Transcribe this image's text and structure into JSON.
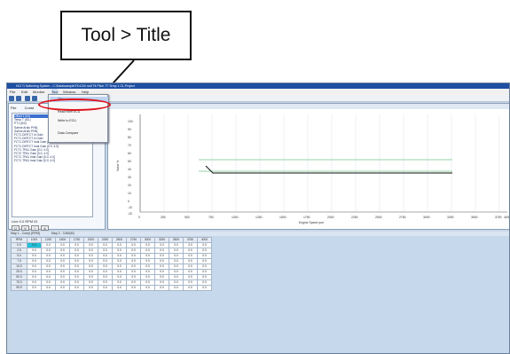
{
  "callout": {
    "text": "Tool > Title"
  },
  "window": {
    "title": "HCI Ti Switching System - C:\\Data\\sample\\TK4100.mdf  Tlt Pitch 7T  Temp 1 CL.Project",
    "menu": [
      "File",
      "Edit",
      "Monitor",
      "Tool",
      "Window",
      "Help"
    ]
  },
  "left_panel": {
    "tabs": [
      "File",
      "Const"
    ],
    "items": [
      "Offset 1 (ini)",
      "Temp T (5/L)",
      "PT1 (5/4)",
      "Sahne Ardio PH5(",
      "Sahne Ardio PH5(",
      "FCT1 DIRTCT ln Gain",
      "FCT1 DIRTCT ln Gain",
      "FCT1 DIRTCT Imal Gain",
      "FCT1 DIRTCT Imal Gain",
      "FCT1 TPA1 Gain",
      "FCT2 TPA1 Gain",
      "FCT1 TPA1 Imal Gain",
      "FCT1 TPA1 Imal Gain"
    ],
    "values": [
      "",
      "",
      "",
      "",
      "",
      "",
      "",
      "[0.0, 4.0]",
      "[0.0, 4.0]",
      "[0.0, 4.0]",
      "[0.0, 4.0]",
      "[0.0, 4.0]",
      "[0.0, 4.0]"
    ],
    "footer": "Line 0.0  RPM  ID",
    "buttons": [
      "U",
      "V",
      "^",
      "A"
    ]
  },
  "dropdown": {
    "items": [
      "Title",
      "Read from ECU",
      "Write to ECU",
      "Data Compare"
    ]
  },
  "chart": {
    "y_ticks": [
      "100",
      "90",
      "80",
      "70",
      "60",
      "50",
      "40",
      "30",
      "20",
      "10",
      "0",
      "-10",
      "-20"
    ],
    "x_ticks": [
      "0",
      "250",
      "500",
      "750",
      "1000",
      "1250",
      "1500",
      "1750",
      "2000",
      "2250",
      "2500",
      "2750",
      "3000",
      "3250",
      "3500",
      "3750",
      "4000"
    ],
    "ylabel": "Value %",
    "xlabel": "Engine Speed rpm"
  },
  "grid": {
    "tabs": [
      "Map 1 - Comp [RPM]",
      "Map 2 - CAM(M)"
    ],
    "col_headers": [
      "RPM",
      "1000",
      "1250",
      "1500",
      "1750",
      "2000",
      "2250",
      "2500",
      "2750",
      "3000",
      "3250",
      "3500",
      "3750",
      "4000"
    ],
    "rows": [
      [
        "0.0",
        "0.0",
        "0.0",
        "0.0",
        "0.0",
        "0.0",
        "0.0",
        "0.0",
        "0.0",
        "0.0",
        "0.0",
        "0.0",
        "0.0",
        "0.0"
      ],
      [
        "2.5",
        "0.0",
        "0.0",
        "0.0",
        "0.0",
        "0.0",
        "0.0",
        "0.0",
        "0.0",
        "0.0",
        "0.0",
        "0.0",
        "0.0",
        "0.0"
      ],
      [
        "5.0",
        "0.0",
        "0.0",
        "0.0",
        "0.0",
        "0.0",
        "0.0",
        "0.0",
        "0.0",
        "0.0",
        "0.0",
        "0.0",
        "0.0",
        "0.0"
      ],
      [
        "7.5",
        "0.0",
        "0.0",
        "0.0",
        "0.0",
        "0.0",
        "0.0",
        "0.0",
        "0.0",
        "0.0",
        "0.0",
        "0.0",
        "0.0",
        "0.0"
      ],
      [
        "10.0",
        "0.0",
        "0.0",
        "0.0",
        "0.0",
        "0.0",
        "0.0",
        "0.0",
        "0.0",
        "0.0",
        "0.0",
        "0.0",
        "0.0",
        "0.0"
      ],
      [
        "25.0",
        "0.0",
        "0.0",
        "0.0",
        "0.0",
        "0.0",
        "0.0",
        "0.0",
        "0.0",
        "0.0",
        "0.0",
        "0.0",
        "0.0",
        "0.0"
      ],
      [
        "50.0",
        "0.0",
        "0.0",
        "0.0",
        "0.0",
        "0.0",
        "0.0",
        "0.0",
        "0.0",
        "0.0",
        "0.0",
        "0.0",
        "0.0",
        "0.0"
      ],
      [
        "75.0",
        "0.0",
        "0.0",
        "0.0",
        "0.0",
        "0.0",
        "0.0",
        "0.0",
        "0.0",
        "0.0",
        "0.0",
        "0.0",
        "0.0",
        "0.0"
      ],
      [
        "99.9",
        "0.0",
        "0.0",
        "0.0",
        "0.0",
        "0.0",
        "0.0",
        "0.0",
        "0.0",
        "0.0",
        "0.0",
        "0.0",
        "0.0",
        "0.0"
      ]
    ]
  },
  "colors": {
    "title_bar": "#1d4fa3",
    "highlight_oval": "#e0121a",
    "selected_cell": "#20c0d8"
  }
}
